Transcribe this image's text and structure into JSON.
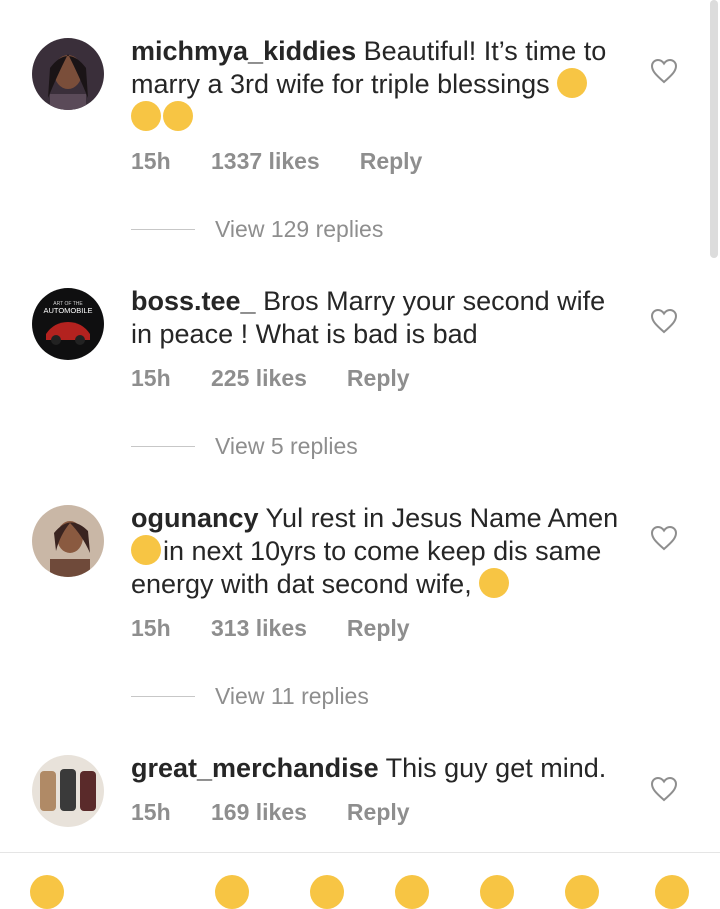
{
  "comments": [
    {
      "username": "michmya_kiddies",
      "text": "Beautiful! It’s time to marry a 3rd wife for triple blessings",
      "time": "15h",
      "likes": "1337 likes",
      "reply": "Reply",
      "view_replies": "View 129 replies",
      "avatar": "woman-portrait"
    },
    {
      "username": "boss.tee_",
      "text": "Bros Marry your second wife in peace ! What is bad is bad",
      "time": "15h",
      "likes": "225 likes",
      "reply": "Reply",
      "view_replies": "View 5 replies",
      "avatar": "art-of-the-automobile-logo",
      "avatar_text_top": "ART OF THE",
      "avatar_text_main": "AUTOMOBILE"
    },
    {
      "username": "ogunancy",
      "text_a": "Yul rest in Jesus Name Amen",
      "text_b": "in next 10yrs to come keep dis same energy with dat second wife,",
      "time": "15h",
      "likes": "313 likes",
      "reply": "Reply",
      "view_replies": "View 11 replies",
      "avatar": "woman-portrait"
    },
    {
      "username": "great_merchandise",
      "text": "This guy get mind.",
      "time": "15h",
      "likes": "169 likes",
      "reply": "Reply",
      "avatar": "car-seats-photo"
    }
  ],
  "colors": {
    "text": "#262626",
    "muted": "#8e8e8e",
    "emoji": "#f7c544"
  },
  "icons": [
    "heart-outline-icon",
    "clapping-hands-emoji",
    "woozy-face-emoji",
    "grinning-face-emoji",
    "tears-of-joy-emoji"
  ]
}
